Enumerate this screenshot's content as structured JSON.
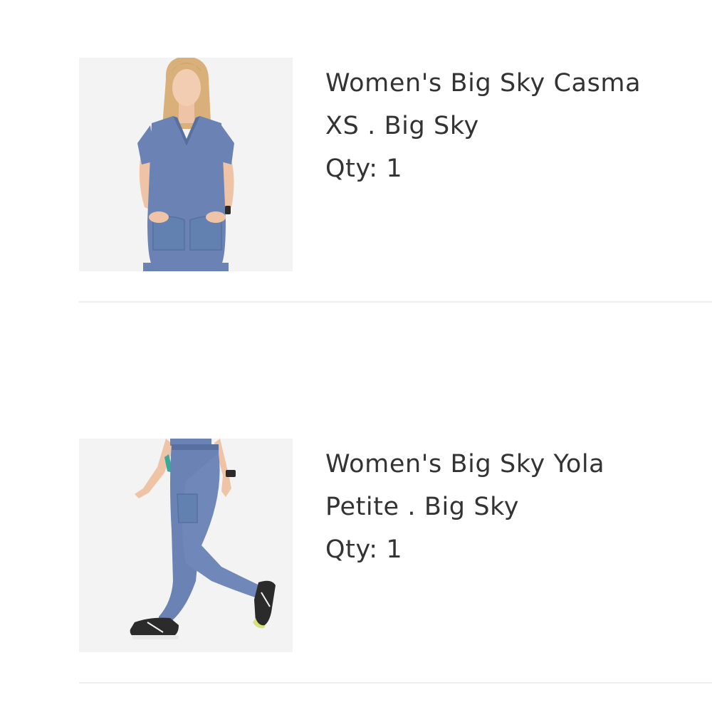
{
  "items": [
    {
      "name": "Women's Big Sky Casma",
      "variant": "XS . Big Sky",
      "qty_label": "Qty:",
      "qty": "1",
      "image_icon": "product-photo-scrub-top"
    },
    {
      "name": "Women's Big Sky Yola",
      "variant": "Petite . Big Sky",
      "qty_label": "Qty:",
      "qty": "1",
      "image_icon": "product-photo-scrub-pants"
    }
  ],
  "colors": {
    "garment": "#6a83b4",
    "garment_shadow": "#58709f",
    "image_background": "#f3f3f3",
    "skin": "#f0c9ac",
    "hair": "#d9b07a",
    "shoe": "#2b2b2b",
    "text": "#333333",
    "divider": "#eeeeee"
  }
}
